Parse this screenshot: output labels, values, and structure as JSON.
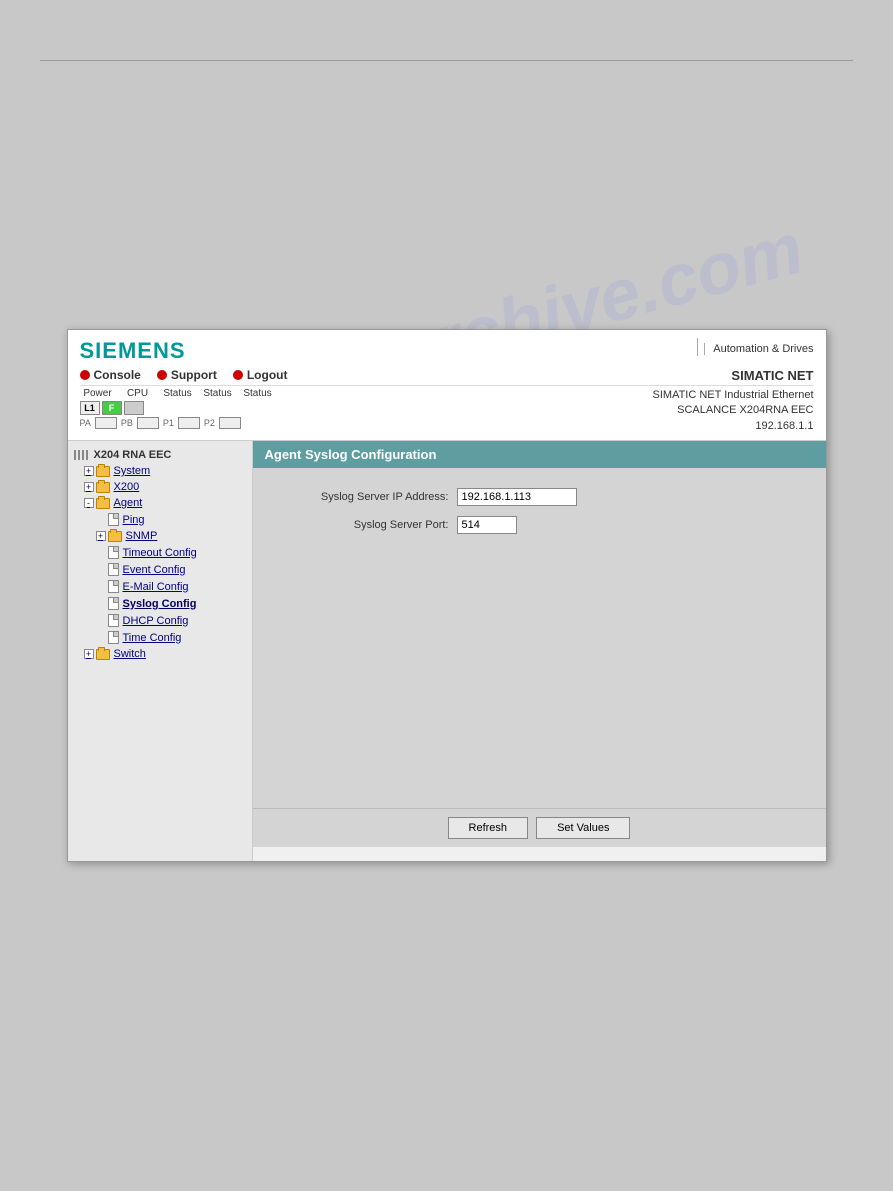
{
  "page": {
    "watermark_line1": "manualsarchive.com"
  },
  "header": {
    "logo": "SIEMENS",
    "automation_drives": "Automation & Drives",
    "nav": {
      "console_label": "Console",
      "support_label": "Support",
      "logout_label": "Logout"
    },
    "simatic_net_label": "SIMATIC NET",
    "device_line1": "SIMATIC NET Industrial Ethernet",
    "device_line2": "SCALANCE X204RNA EEC",
    "device_ip": "192.168.1.1",
    "status_labels": {
      "power": "Power",
      "cpu": "CPU",
      "status1": "Status",
      "status2": "Status",
      "status3": "Status"
    },
    "l1_label": "L1",
    "f_label": "F",
    "port_labels": [
      "PA",
      "PB",
      "P1",
      "P2"
    ]
  },
  "sidebar": {
    "root_label": "X204 RNA EEC",
    "items": [
      {
        "id": "system",
        "label": "System",
        "type": "folder",
        "indent": 1,
        "expanded": true
      },
      {
        "id": "x200",
        "label": "X200",
        "type": "folder",
        "indent": 1,
        "expanded": true
      },
      {
        "id": "agent",
        "label": "Agent",
        "type": "folder",
        "indent": 1,
        "expanded": true
      },
      {
        "id": "ping",
        "label": "Ping",
        "type": "doc",
        "indent": 3
      },
      {
        "id": "snmp",
        "label": "SNMP",
        "type": "folder",
        "indent": 2,
        "expanded": false
      },
      {
        "id": "timeout-config",
        "label": "Timeout Config",
        "type": "doc",
        "indent": 3
      },
      {
        "id": "event-config",
        "label": "Event Config",
        "type": "doc",
        "indent": 3
      },
      {
        "id": "email-config",
        "label": "E-Mail Config",
        "type": "doc",
        "indent": 3
      },
      {
        "id": "syslog-config",
        "label": "Syslog Config",
        "type": "doc",
        "indent": 3
      },
      {
        "id": "dhcp-config",
        "label": "DHCP Config",
        "type": "doc",
        "indent": 3
      },
      {
        "id": "time-config",
        "label": "Time Config",
        "type": "doc",
        "indent": 3
      },
      {
        "id": "switch",
        "label": "Switch",
        "type": "folder",
        "indent": 1,
        "expanded": false
      }
    ]
  },
  "content": {
    "title": "Agent Syslog Configuration",
    "form": {
      "ip_label": "Syslog Server IP Address:",
      "ip_value": "192.168.1.113",
      "port_label": "Syslog Server Port:",
      "port_value": "514"
    },
    "buttons": {
      "refresh": "Refresh",
      "set_values": "Set Values"
    }
  }
}
